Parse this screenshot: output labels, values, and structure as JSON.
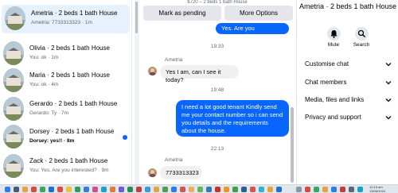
{
  "conversations": [
    {
      "title": "Ametria · 2 beds 1 bath House",
      "subtitle": "Ametria: 7733313323 · 1m",
      "active": true
    },
    {
      "title": "Olivia · 2 beds 1 bath House",
      "subtitle": "You: ok · 1m"
    },
    {
      "title": "Maria · 2 beds 1 bath House",
      "subtitle": "You: ok · 4m"
    },
    {
      "title": "Gerardo · 2 beds 1 bath House",
      "subtitle": "Gerardo: Ty · 7m"
    },
    {
      "title": "Dorsey · 2 beds 1 bath House",
      "subtitle": "Dorsey: yes!! · 8m",
      "unread": true
    },
    {
      "title": "Zack · 2 beds 1 bath House",
      "subtitle": "You: Yes. Are you interested? · 9m"
    }
  ],
  "chat": {
    "top_partial": "$720 – 2 beds 1 bath House",
    "mark_pending_label": "Mark as pending",
    "more_options_label": "More Options",
    "messages": {
      "m1": "Yes. Are you interested?",
      "t1": "19:33",
      "sender1": "Ametria",
      "m2": "Yes I am, can I see it today?",
      "t2": "19:48",
      "m3": "I need a lot good tenant Kindly send me your contact number so i can send you details and the requirements about the house.",
      "t3": "22:13",
      "sender2": "Ametria",
      "m4": "7733313323"
    }
  },
  "info": {
    "title": "Ametria · 2 beds 1 bath House",
    "mute_label": "Mute",
    "search_label": "Search",
    "sections": [
      "Customise chat",
      "Chat members",
      "Media, files and links",
      "Privacy and support"
    ]
  },
  "taskbar": {
    "time": "12:13 am",
    "date": "13/06/2024"
  },
  "colors": {
    "accent": "#0866ff",
    "active_row": "#e7f0fd",
    "button_bg": "#e4e6eb"
  },
  "icons": [
    "mute-bell-icon",
    "search-icon",
    "chevron-down-icon"
  ]
}
